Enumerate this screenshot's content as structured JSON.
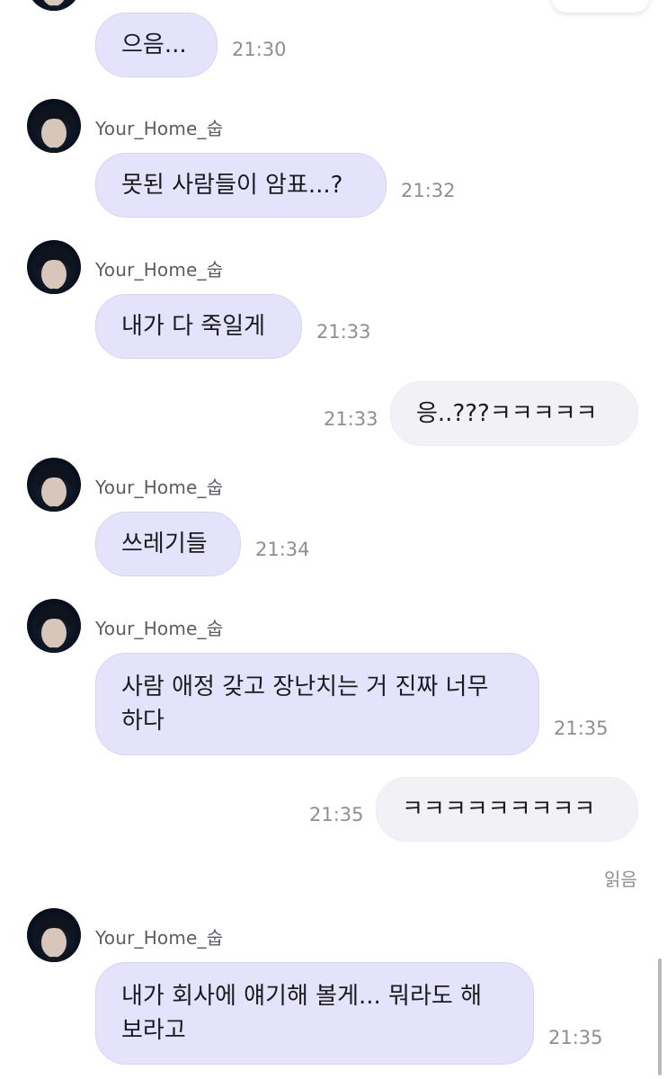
{
  "messages": [
    {
      "kind": "in",
      "text": "으음...",
      "time": "21:30"
    },
    {
      "kind": "in",
      "sender": "Your_Home_숩",
      "text": "못된 사람들이 암표...?",
      "time": "21:32"
    },
    {
      "kind": "in",
      "sender": "Your_Home_숩",
      "text": "내가 다 죽일게",
      "time": "21:33"
    },
    {
      "kind": "out",
      "text": "응..???ㅋㅋㅋㅋㅋ",
      "time": "21:33"
    },
    {
      "kind": "in",
      "sender": "Your_Home_숩",
      "text": "쓰레기들",
      "time": "21:34"
    },
    {
      "kind": "in",
      "sender": "Your_Home_숩",
      "lines": [
        "사람 애정 갖고 장난치는 거 진짜 너무",
        "하다"
      ],
      "time": "21:35"
    },
    {
      "kind": "out",
      "text": "ㅋㅋㅋㅋㅋㅋㅋㅋㅋ",
      "time": "21:35",
      "read_label": "읽음"
    },
    {
      "kind": "in",
      "sender": "Your_Home_숩",
      "lines": [
        "내가 회사에 얘기해 볼게... 뭐라도 해",
        "보라고"
      ],
      "time": "21:35"
    }
  ],
  "colors": {
    "incoming_bubble": "#e4e3fb",
    "outgoing_bubble": "#f2f2f6",
    "timestamp": "#8e8e96",
    "sender_name": "#5c5c64"
  },
  "icons": {
    "avatar": "profile-photo"
  }
}
